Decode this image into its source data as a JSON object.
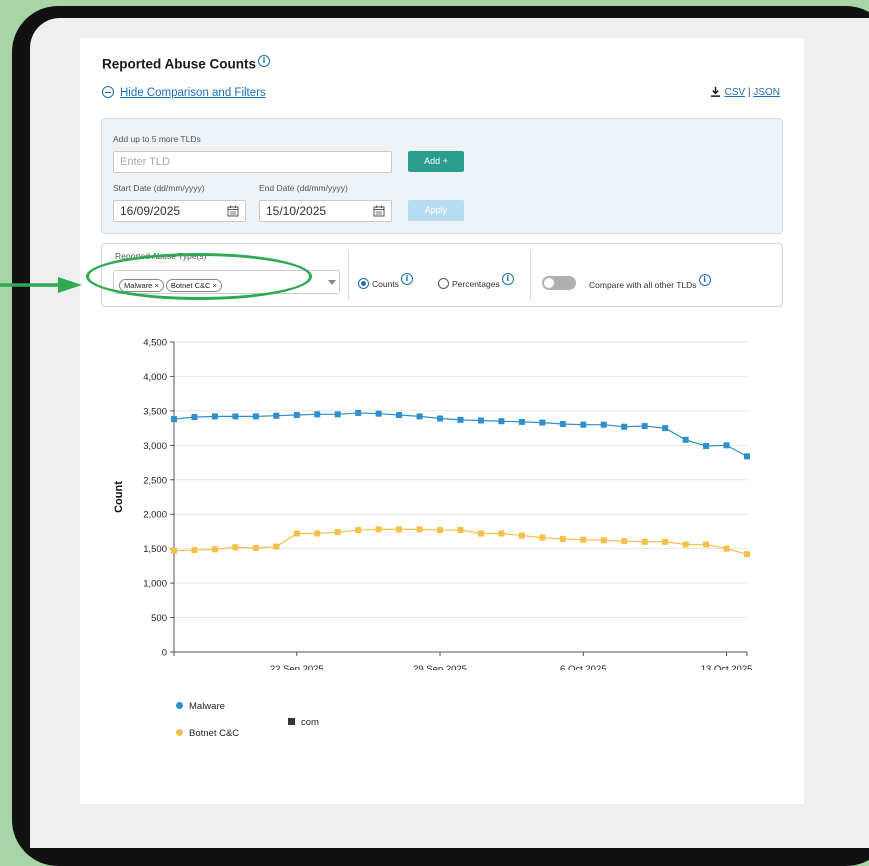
{
  "page": {
    "title": "Reported Abuse Counts",
    "hide_filters_label": "Hide Comparison and Filters",
    "download": {
      "csv": "CSV",
      "separator": "|",
      "json": "JSON"
    }
  },
  "filters": {
    "add_tld_label": "Add up to 5 more TLDs",
    "tld_placeholder": "Enter TLD",
    "add_button": "Add +",
    "start_date_label": "Start Date (dd/mm/yyyy)",
    "start_date_value": "16/09/2025",
    "end_date_label": "End Date (dd/mm/yyyy)",
    "end_date_value": "15/10/2025",
    "apply_button": "Apply"
  },
  "options": {
    "abuse_type_label": "Reported Abuse Type(s)",
    "selected_types": [
      "Malware",
      "Botnet C&C"
    ],
    "chip_remove": "×",
    "counts_label": "Counts",
    "percentages_label": "Percentages",
    "selected_mode": "Counts",
    "compare_label": "Compare with all other TLDs",
    "compare_enabled": false
  },
  "colors": {
    "malware": "#2e8fcb",
    "botnet": "#f5c04a",
    "accent": "#2a9d8f",
    "highlight": "#2eaa55"
  },
  "chart_data": {
    "type": "line",
    "ylabel": "Count",
    "xlabel": "",
    "ylim": [
      0,
      4500
    ],
    "yticks": [
      0,
      500,
      1000,
      1500,
      2000,
      2500,
      3000,
      3500,
      4000,
      4500
    ],
    "ytick_labels": [
      "0",
      "500",
      "1,000",
      "1,500",
      "2,000",
      "2,500",
      "3,000",
      "3,500",
      "4,000",
      "4,500"
    ],
    "x_start": "16 Sep 2025",
    "x": [
      "2025-09-16",
      "2025-09-17",
      "2025-09-18",
      "2025-09-19",
      "2025-09-20",
      "2025-09-21",
      "2025-09-22",
      "2025-09-23",
      "2025-09-24",
      "2025-09-25",
      "2025-09-26",
      "2025-09-27",
      "2025-09-28",
      "2025-09-29",
      "2025-09-30",
      "2025-10-01",
      "2025-10-02",
      "2025-10-03",
      "2025-10-04",
      "2025-10-05",
      "2025-10-06",
      "2025-10-07",
      "2025-10-08",
      "2025-10-09",
      "2025-10-10",
      "2025-10-11",
      "2025-10-12",
      "2025-10-13",
      "2025-10-14"
    ],
    "xticks": [
      6,
      13,
      20,
      27
    ],
    "xtick_labels": [
      "22 Sep 2025",
      "29 Sep 2025",
      "6 Oct 2025",
      "13 Oct 2025"
    ],
    "series": [
      {
        "name": "Malware",
        "tld": "com",
        "values": [
          3380,
          3410,
          3420,
          3420,
          3420,
          3430,
          3440,
          3450,
          3450,
          3470,
          3460,
          3440,
          3420,
          3390,
          3370,
          3360,
          3350,
          3340,
          3330,
          3310,
          3300,
          3300,
          3270,
          3280,
          3250,
          3080,
          2990,
          3000,
          2840
        ]
      },
      {
        "name": "Botnet C&C",
        "tld": "com",
        "values": [
          1470,
          1480,
          1490,
          1520,
          1510,
          1530,
          1720,
          1720,
          1740,
          1770,
          1780,
          1780,
          1780,
          1770,
          1770,
          1720,
          1720,
          1690,
          1660,
          1640,
          1630,
          1620,
          1610,
          1600,
          1600,
          1560,
          1560,
          1500,
          1420
        ]
      }
    ],
    "legend": {
      "types": [
        "Malware",
        "Botnet C&C"
      ],
      "tlds": [
        "com"
      ],
      "placement": "bottom-left"
    },
    "grid": true
  }
}
